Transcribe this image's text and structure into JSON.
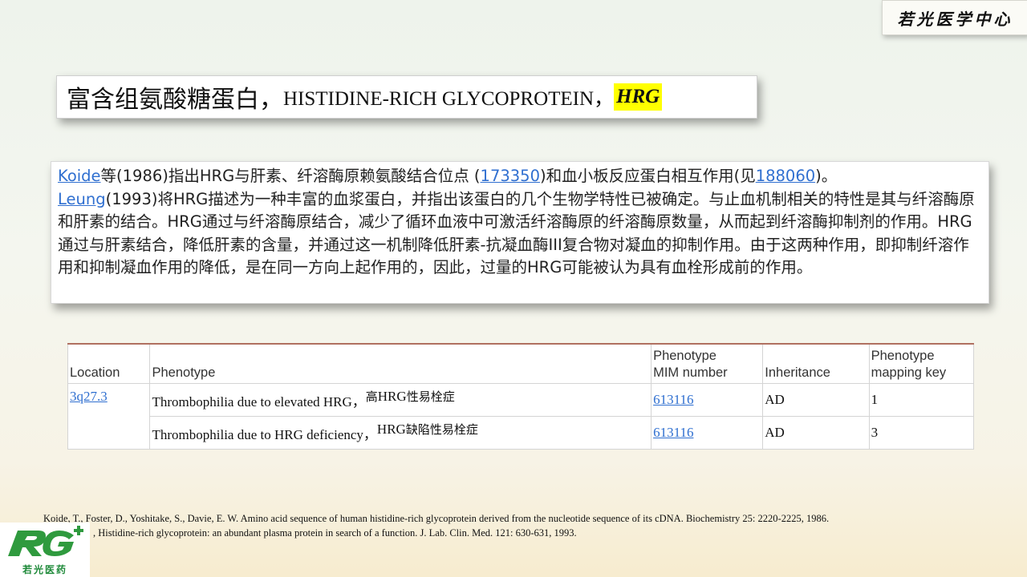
{
  "brand": {
    "name": "若光医学中心"
  },
  "title": {
    "cn": "富含组氨酸糖蛋白，",
    "en": "HISTIDINE-RICH GLYCOPROTEIN，",
    "abbr": "HRG",
    "highlight_color": "#ffff00"
  },
  "paragraph": {
    "link1": "Koide",
    "t1": "等(1986)指出HRG与肝素、纤溶酶原赖氨酸结合位点 (",
    "link2": "173350",
    "t2": ")和血小板反应蛋白相互作用(见",
    "link3": "188060",
    "t3": ")。",
    "link4": "Leung",
    "t4": "(1993)将HRG描述为一种丰富的血浆蛋白，并指出该蛋白的几个生物学特性已被确定。与止血机制相关的特性是其与纤溶酶原和肝素的结合。HRG通过与纤溶酶原结合，减少了循环血液中可激活纤溶酶原的纤溶酶原数量，从而起到纤溶酶抑制剂的作用。HRG通过与肝素结合，降低肝素的含量，并通过这一机制降低肝素-抗凝血酶III复合物对凝血的抑制作用。由于这两种作用，即抑制纤溶作用和抑制凝血作用的降低，是在同一方向上起作用的，因此，过量的HRG可能被认为具有血栓形成前的作用。",
    "link_color": "#2f6fd0"
  },
  "table": {
    "headers": {
      "location": "Location",
      "phenotype": "Phenotype",
      "mim_l1": "Phenotype",
      "mim_l2": "MIM number",
      "inheritance": "Inheritance",
      "key_l1": "Phenotype",
      "key_l2": "mapping key"
    },
    "location": "3q27.3",
    "rows": [
      {
        "phenotype": "Thrombophilia due to elevated HRG，",
        "pheno_cn_pre": "高",
        "pheno_cn_en": "HRG",
        "pheno_cn_post": "性易栓症",
        "mim": "613116",
        "inheritance": "AD",
        "key": "1"
      },
      {
        "phenotype": "Thrombophilia due to HRG deficiency，",
        "pheno_cn_pre": "",
        "pheno_cn_en": "HRG",
        "pheno_cn_post": "缺陷性易栓症",
        "mim": "613116",
        "inheritance": "AD",
        "key": "3"
      }
    ]
  },
  "references": [
    "Koide, T., Foster, D., Yoshitake, S., Davie, E. W. Amino  acid sequence of human histidine-rich  glycoprotein  derived  from the nucleotide  sequence of its cDNA. Biochemistry 25:  2220-2225,  1986.",
    ", Histidine-rich  glycoprotein:  an abundant plasma protein  in search of a function.  J. Lab. Clin.  Med. 121:  630-631,  1993."
  ],
  "logo": {
    "text": "若光医药",
    "color": "#1f8a3a"
  }
}
